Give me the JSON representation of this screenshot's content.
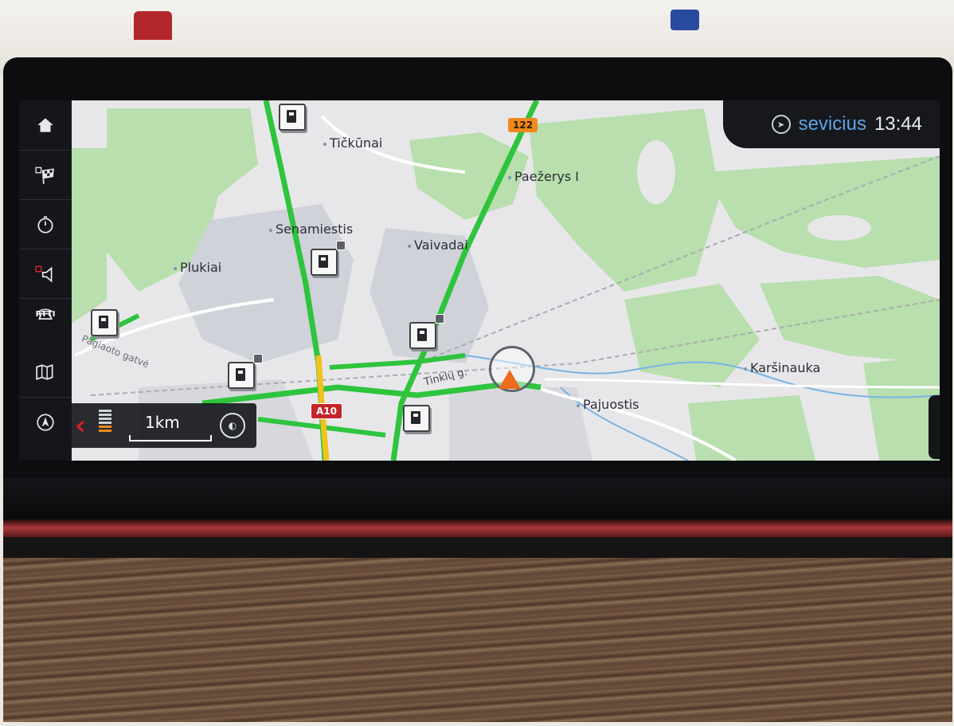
{
  "status_bar": {
    "destination": "sevicius",
    "time": "13:44",
    "nav_icon": "navigation-arrow-icon"
  },
  "sidebar": {
    "items": [
      {
        "name": "home",
        "icon": "home-icon"
      },
      {
        "name": "destination",
        "icon": "checkered-flag-icon"
      },
      {
        "name": "timer",
        "icon": "stopwatch-icon"
      },
      {
        "name": "voice",
        "icon": "speaker-icon"
      },
      {
        "name": "traffic",
        "icon": "traffic-info-icon",
        "label": "RTTI"
      },
      {
        "name": "map",
        "icon": "map-icon"
      },
      {
        "name": "compass",
        "icon": "compass-icon"
      }
    ]
  },
  "scale_panel": {
    "scale_label": "1km",
    "zoom_level": 0.25,
    "back_icon": "chevron-left-icon",
    "orientation_icon": "map-orientation-icon"
  },
  "map": {
    "places": [
      {
        "name": "Tičkūnai"
      },
      {
        "name": "Paežerys I"
      },
      {
        "name": "Senamiestis"
      },
      {
        "name": "Vaivadai"
      },
      {
        "name": "Plukiai"
      },
      {
        "name": "Karšinauka"
      },
      {
        "name": "Pajuostis"
      }
    ],
    "streets": [
      "Tinklų g.",
      "Pagiaoto gatvė"
    ],
    "road_numbers": [
      "A10",
      "122"
    ],
    "poi_icon": "fuel-station-icon",
    "vehicle_icon": "vehicle-position-icon",
    "colors": {
      "land": "#e7e7ea",
      "forest": "#b8dfad",
      "urban": "#cfd2d8",
      "traffic_free": "#2ec43d",
      "traffic_slow": "#f2c21c",
      "water": "#79b3e4",
      "accent": "#5da3e6",
      "vehicle": "#ee6a1f"
    }
  }
}
